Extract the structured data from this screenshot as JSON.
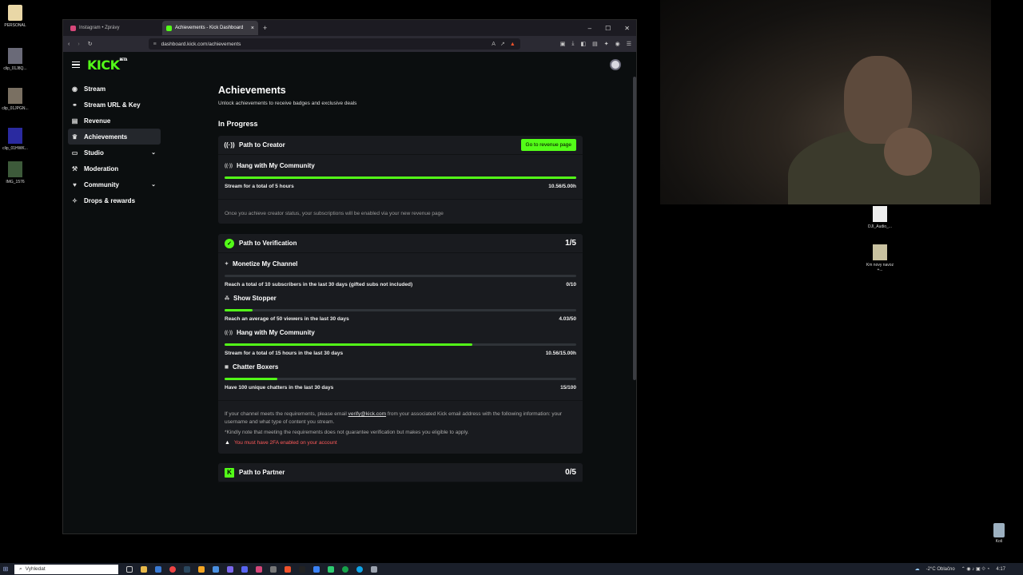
{
  "desktop": {
    "left_icons": [
      {
        "label": "PERSONAL"
      },
      {
        "label": "clip_01J8Q..."
      },
      {
        "label": "clip_01JPGN..."
      },
      {
        "label": "clip_01HWK..."
      },
      {
        "label": "IMG_1576"
      }
    ],
    "right_icons": [
      {
        "label": "DJI_Audio_..."
      },
      {
        "label": "Km novy navoz +..."
      }
    ],
    "recycle_bin": "Koš"
  },
  "browser": {
    "tabs": [
      {
        "title": "Instagram • Zprávy",
        "active": false
      },
      {
        "title": "Achievements - Kick Dashboard",
        "active": true
      }
    ],
    "url": "dashboard.kick.com/achievements"
  },
  "app": {
    "logo": "KICK",
    "logo_badge": "BETA",
    "sidebar": [
      {
        "label": "Stream",
        "icon": "stream-icon",
        "active": false
      },
      {
        "label": "Stream URL & Key",
        "icon": "link-icon",
        "active": false
      },
      {
        "label": "Revenue",
        "icon": "revenue-icon",
        "active": false
      },
      {
        "label": "Achievements",
        "icon": "trophy-icon",
        "active": true
      },
      {
        "label": "Studio",
        "icon": "studio-icon",
        "active": false,
        "expandable": true
      },
      {
        "label": "Moderation",
        "icon": "hammer-icon",
        "active": false
      },
      {
        "label": "Community",
        "icon": "community-icon",
        "active": false,
        "expandable": true
      },
      {
        "label": "Drops & rewards",
        "icon": "gift-icon",
        "active": false
      }
    ],
    "page": {
      "title": "Achievements",
      "subtitle": "Unlock achievements to receive badges and exclusive deals",
      "in_progress_title": "In Progress"
    },
    "creator": {
      "title": "Path to Creator",
      "button": "Go to revenue page",
      "achievements": [
        {
          "title": "Hang with My Community",
          "desc": "Stream for a total of 5 hours",
          "value": "10.56/5.00h",
          "progress": 1.0
        }
      ],
      "note": "Once you achieve creator status, your subscriptions will be enabled via your new revenue page"
    },
    "verification": {
      "title": "Path to Verification",
      "count": "1/5",
      "achievements": [
        {
          "title": "Monetize My Channel",
          "desc": "Reach a total of 10 subscribers in the last 30 days (gifted subs not included)",
          "value": "0/10",
          "progress": 0.0
        },
        {
          "title": "Show Stopper",
          "desc": "Reach an average of 50 viewers in the last 30 days",
          "value": "4.03/50",
          "progress": 0.08
        },
        {
          "title": "Hang with My Community",
          "desc": "Stream for a total of 15 hours in the last 30 days",
          "value": "10.56/15.00h",
          "progress": 0.704
        },
        {
          "title": "Chatter Boxers",
          "desc": "Have 100 unique chatters in the last 30 days",
          "value": "15/100",
          "progress": 0.15
        }
      ],
      "footnote_pre": "If your channel meets the requirements, please email ",
      "footnote_email": "verify@kick.com",
      "footnote_post": " from your associated Kick email address with the following information: your username and what type of content you stream.",
      "footnote2": "*Kindly note that meeting the requirements does not guarantee verification but makes you eligible to apply.",
      "warning": "You must have 2FA enabled on your account"
    },
    "partner": {
      "title": "Path to Partner",
      "count": "0/5"
    }
  },
  "taskbar": {
    "search_placeholder": "Vyhledat",
    "weather": "-2°C Oblačno",
    "time": "4:17"
  },
  "colors": {
    "accent": "#53fc18",
    "warning": "#ff5a5a",
    "card": "#191b1f",
    "page_bg": "#0b0e0f"
  }
}
